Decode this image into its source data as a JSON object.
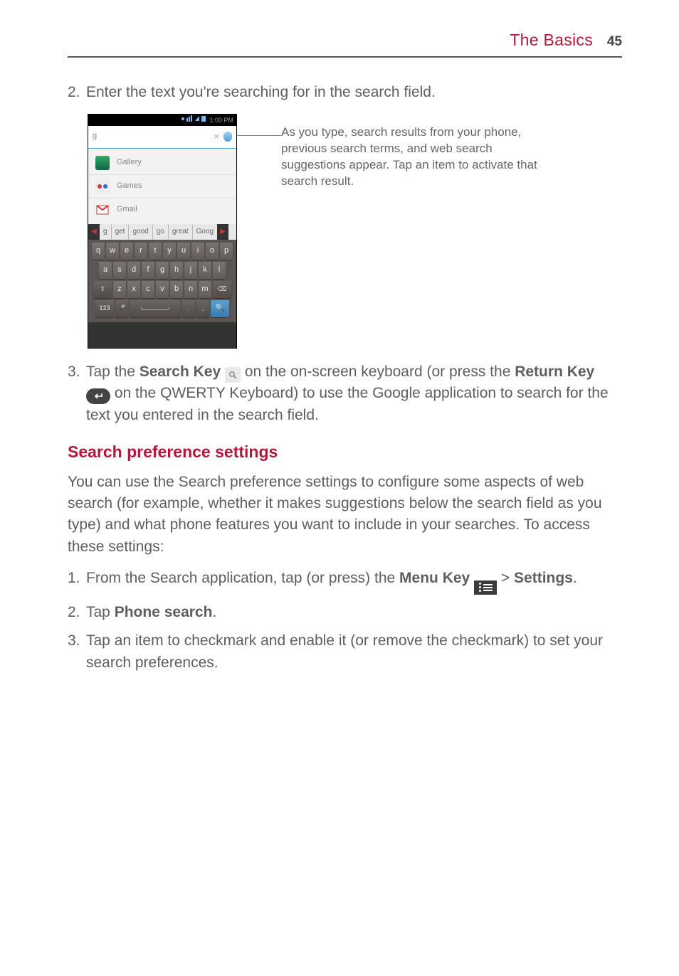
{
  "header": {
    "title": "The Basics",
    "page_number": "45"
  },
  "step2": {
    "num": "2.",
    "text": "Enter the text you're searching for in the search field."
  },
  "phone": {
    "time": "1:00 PM",
    "search_cursor": "g",
    "clear_x": "×",
    "suggestions": {
      "gallery": "Gallery",
      "games": "Games",
      "gmail": "Gmail"
    },
    "predictions": {
      "left_arrow": "◀",
      "g": "g",
      "get": "get",
      "good": "good",
      "go": "go",
      "great": "great",
      "goog": "Goog",
      "right_arrow": "▶"
    },
    "keys": {
      "row1": [
        "q",
        "w",
        "e",
        "r",
        "t",
        "y",
        "u",
        "i",
        "o",
        "p"
      ],
      "row2": [
        "a",
        "s",
        "d",
        "f",
        "g",
        "h",
        "j",
        "k",
        "l"
      ],
      "row3_shift": "⇧",
      "row3": [
        "z",
        "x",
        "c",
        "v",
        "b",
        "n",
        "m"
      ],
      "row3_del": "⌫",
      "row4_sym": "123",
      "row4_mic": "🎤",
      "row4_space": " ",
      "row4_dot": ".",
      "row4_comma": ",",
      "row4_search": "🔍"
    }
  },
  "callout": "As you type, search results from your phone, previous search terms, and web search suggestions appear. Tap an item to activate that search result.",
  "step3": {
    "num": "3.",
    "a": "Tap the ",
    "b": "Search Key",
    "c": " on the on-screen keyboard (or press the ",
    "d": "Return Key",
    "e": " on the QWERTY Keyboard) to use the Google application to search for the text you entered in the search field.",
    "search_icon": "🔍",
    "return_icon": "↵"
  },
  "section_heading": "Search preference settings",
  "section_para": "You can use the Search preference settings to configure some aspects of web search (for example, whether it makes suggestions below the search field as you type) and what phone features you want to include in your searches. To access these settings:",
  "s1": {
    "num": "1.",
    "a": "From the Search application, tap (or press) the ",
    "b": "Menu Key",
    "c": " > ",
    "d": "Settings",
    "e": "."
  },
  "s2": {
    "num": "2.",
    "a": "Tap ",
    "b": "Phone search",
    "c": "."
  },
  "s3": {
    "num": "3.",
    "text": "Tap an item to checkmark and enable it (or remove the checkmark) to set your search preferences."
  }
}
